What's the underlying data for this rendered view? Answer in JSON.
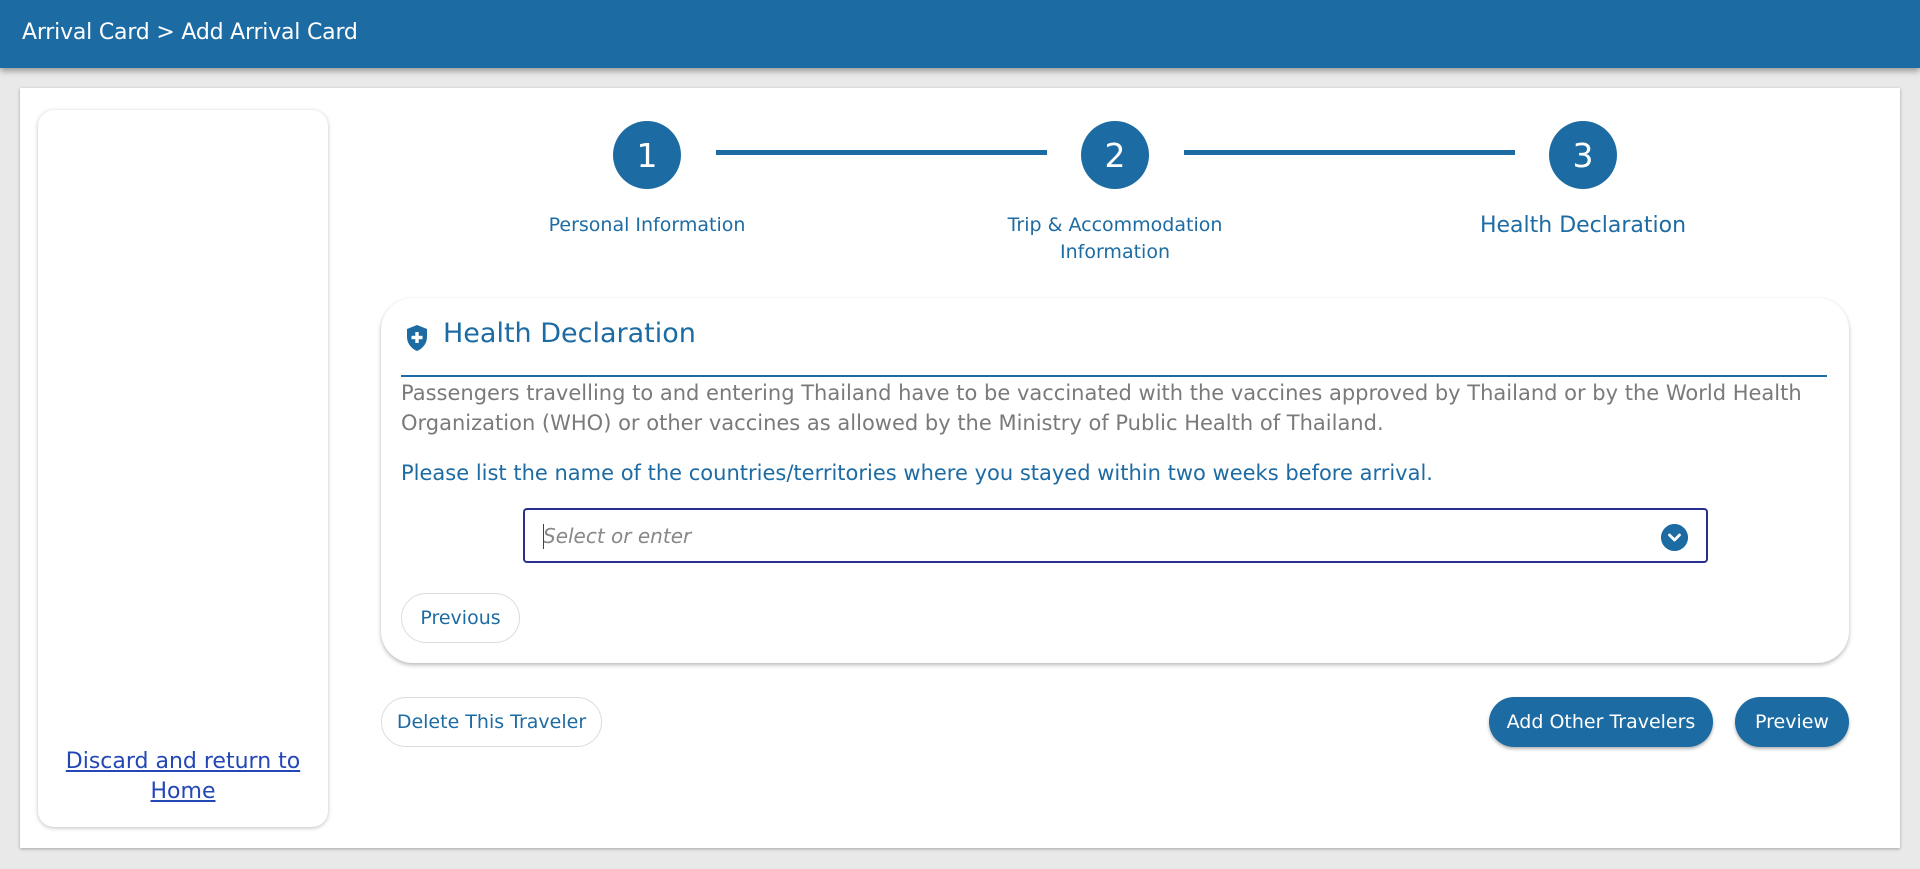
{
  "header": {
    "breadcrumb": "Arrival Card > Add Arrival Card"
  },
  "sidebar": {
    "discard_link": "Discard and return to Home"
  },
  "stepper": {
    "steps": [
      {
        "number": "1",
        "label": "Personal Information",
        "state": "complete"
      },
      {
        "number": "2",
        "label": "Trip & Accommodation Information",
        "state": "complete"
      },
      {
        "number": "3",
        "label": "Health Declaration",
        "state": "active"
      }
    ]
  },
  "health_card": {
    "title": "Health Declaration",
    "description": "Passengers travelling to and entering Thailand have to be vaccinated with the vaccines approved by Thailand or by the World Health Organization (WHO) or other vaccines as allowed by the Ministry of Public Health of Thailand.",
    "question": "Please list the name of the countries/territories where you stayed within two weeks before arrival.",
    "countries_select": {
      "placeholder": "Select or enter",
      "value": ""
    },
    "previous_button": "Previous"
  },
  "actions": {
    "delete_button": "Delete This Traveler",
    "add_travelers_button": "Add Other Travelers",
    "preview_button": "Preview"
  },
  "colors": {
    "primary": "#1d6ba3",
    "link": "#2347b5",
    "muted_text": "#7a7a7a",
    "page_background": "#e9e9e9"
  },
  "icons": [
    "shield-plus-icon",
    "chevron-down-icon"
  ]
}
